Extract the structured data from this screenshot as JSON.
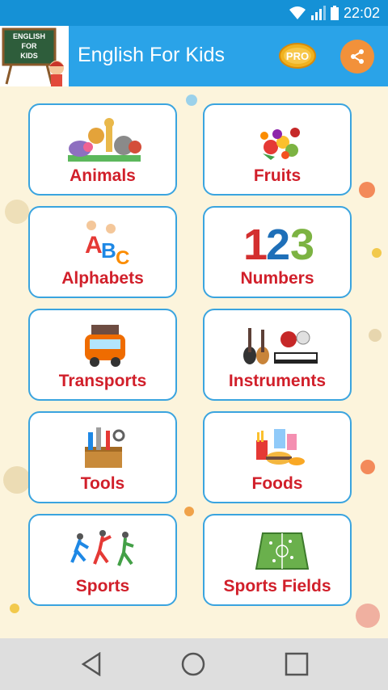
{
  "status_bar": {
    "time": "22:02"
  },
  "app_bar": {
    "title": "English For Kids",
    "pro_badge": "PRO",
    "logo_text": [
      "ENGLISH",
      "FOR",
      "KIDS"
    ]
  },
  "categories": [
    {
      "label": "Animals",
      "icon": "animals-icon"
    },
    {
      "label": "Fruits",
      "icon": "fruits-icon"
    },
    {
      "label": "Alphabets",
      "icon": "alphabets-icon"
    },
    {
      "label": "Numbers",
      "icon": "numbers-icon"
    },
    {
      "label": "Transports",
      "icon": "transports-icon"
    },
    {
      "label": "Instruments",
      "icon": "instruments-icon"
    },
    {
      "label": "Tools",
      "icon": "tools-icon"
    },
    {
      "label": "Foods",
      "icon": "foods-icon"
    },
    {
      "label": "Sports",
      "icon": "sports-icon"
    },
    {
      "label": "Sports Fields",
      "icon": "sports-fields-icon"
    }
  ],
  "numbers_art": [
    "1",
    "2",
    "3"
  ],
  "colors": {
    "status_bar": "#1591d6",
    "app_bar": "#2aa3e8",
    "tile_border": "#3aa4df",
    "label": "#d11f2a",
    "share": "#f2913a"
  }
}
